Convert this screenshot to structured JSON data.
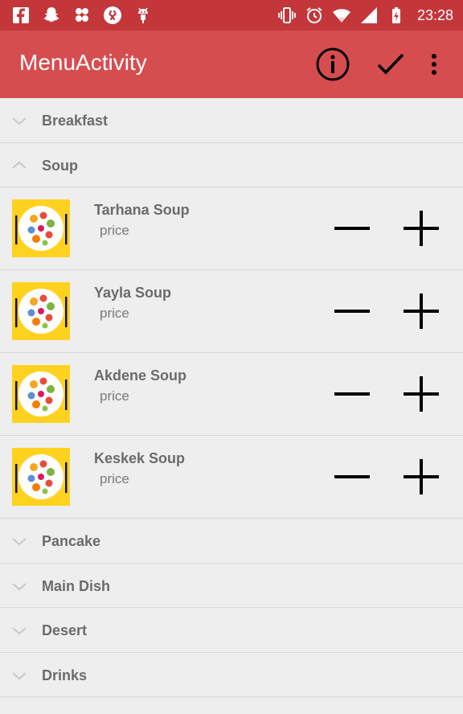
{
  "status_bar": {
    "time": "23:28",
    "left_icons": [
      "facebook-icon",
      "snapchat-icon",
      "pinwheel-icon",
      "shazam-icon",
      "android-debug-icon"
    ],
    "right_icons": [
      "vibrate-icon",
      "alarm-icon",
      "wifi-icon",
      "signal-icon",
      "battery-charging-icon"
    ]
  },
  "app_bar": {
    "title": "MenuActivity",
    "actions": [
      "info-icon",
      "checkmark-icon",
      "overflow-menu-icon"
    ]
  },
  "menu": {
    "groups_before": [
      {
        "label": "Breakfast",
        "expanded": false
      },
      {
        "label": "Soup",
        "expanded": true
      }
    ],
    "soup_items": [
      {
        "name": "Tarhana Soup",
        "price": "price"
      },
      {
        "name": "Yayla Soup",
        "price": "price"
      },
      {
        "name": "Akdene Soup",
        "price": "price"
      },
      {
        "name": "Keskek Soup",
        "price": "price"
      }
    ],
    "groups_after": [
      {
        "label": "Pancake",
        "expanded": false
      },
      {
        "label": "Main Dish",
        "expanded": false
      },
      {
        "label": "Desert",
        "expanded": false
      },
      {
        "label": "Drinks",
        "expanded": false
      }
    ]
  },
  "colors": {
    "status_bar": "#c3363a",
    "app_bar": "#d64d50",
    "background": "#eeeeee",
    "text_gray": "#6b6b6b",
    "thumb_yellow": "#ffd21f"
  }
}
